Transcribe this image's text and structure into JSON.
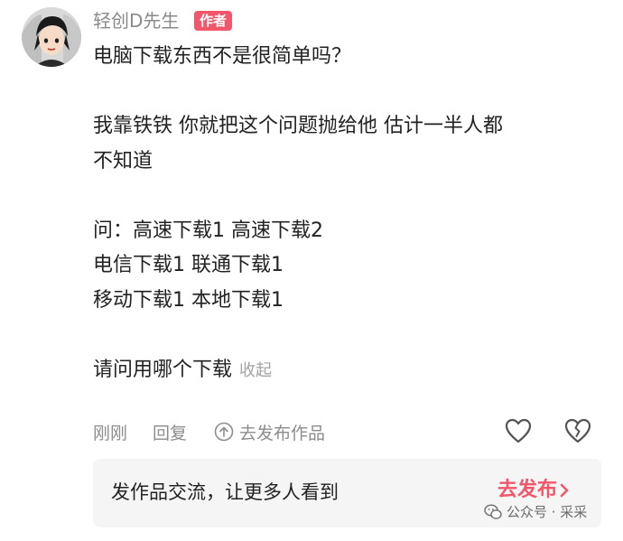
{
  "user": {
    "name": "轻创D先生",
    "badge": "作者"
  },
  "comment": {
    "lines": [
      "电脑下载东西不是很简单吗？",
      "",
      "我靠铁铁 你就把这个问题抛给他 估计一半人都",
      "不知道",
      "",
      "问：高速下载1 高速下载2",
      "电信下载1 联通下载1",
      "移动下载1 本地下载1",
      ""
    ],
    "last_line": "请问用哪个下载",
    "collapse_label": "收起"
  },
  "actions": {
    "time": "刚刚",
    "reply": "回复",
    "publish": "去发布作品"
  },
  "promo": {
    "text": "发作品交流，让更多人看到",
    "cta": "去发布"
  },
  "watermark": {
    "text": "公众号 · 采采"
  },
  "colors": {
    "accent": "#f1566b",
    "text": "#222222",
    "muted": "#8c8c8c",
    "panel": "#f5f5f5"
  },
  "icons": {
    "avatar": "anime-avatar",
    "publish": "arrow-up-circle-icon",
    "like": "heart-outline-icon",
    "dislike": "broken-heart-outline-icon",
    "cta": "chevron-right-icon",
    "watermark": "wechat-icon"
  }
}
